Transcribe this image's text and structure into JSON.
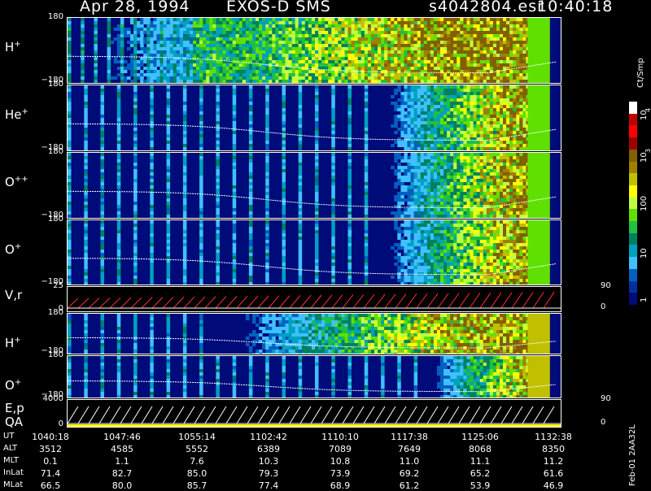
{
  "header": {
    "date": "Apr 28, 1994",
    "mission": "EXOS-D SMS",
    "file": "s4042804.esr",
    "time": "10:40:18"
  },
  "panels": [
    {
      "label": "H",
      "sup": "+",
      "top": "180",
      "bottom": "−180"
    },
    {
      "label": "He",
      "sup": "+",
      "top": "180",
      "bottom": "−180"
    },
    {
      "label": "O",
      "sup": "++",
      "top": "180",
      "bottom": "−180"
    },
    {
      "label": "O",
      "sup": "+",
      "top": "180",
      "bottom": "−180"
    },
    {
      "label": "V,r",
      "sup": "",
      "top": "25",
      "bottom": "0",
      "right_top": "90",
      "right_bottom": "0"
    },
    {
      "label": "H",
      "sup": "+",
      "top": "180",
      "bottom": "−180"
    },
    {
      "label": "O",
      "sup": "+",
      "top": "180",
      "bottom": "−180"
    },
    {
      "label": "E,p",
      "sup": "",
      "label2": "QA",
      "top": "4000",
      "bottom": "0",
      "right_top": "90",
      "right_bottom": "0"
    }
  ],
  "colorbar": {
    "unit": "Ct/Smp",
    "labels": [
      "10",
      "4",
      "10",
      "3",
      "100",
      "10",
      "1"
    ],
    "colors": [
      "#ffffff",
      "#c00000",
      "#ff0000",
      "#a00000",
      "#806000",
      "#a08000",
      "#c0c000",
      "#ffff00",
      "#c0ff40",
      "#60e000",
      "#20c040",
      "#008060",
      "#00a0c0",
      "#40c0ff",
      "#0060c0",
      "#0030a0",
      "#000b7a"
    ]
  },
  "footer_id": "Feb-01 2AA32L",
  "table": {
    "rows": [
      {
        "label": "UT",
        "values": [
          "1040:18",
          "1047:46",
          "1055:14",
          "1102:42",
          "1110:10",
          "1117:38",
          "1125:06",
          "1132:38"
        ]
      },
      {
        "label": "ALT",
        "values": [
          "3512",
          "4585",
          "5552",
          "6389",
          "7089",
          "7649",
          "8068",
          "8350"
        ]
      },
      {
        "label": "MLT",
        "values": [
          "0.1",
          "1.1",
          "7.6",
          "10.3",
          "10.8",
          "11.0",
          "11.1",
          "11.2"
        ]
      },
      {
        "label": "InLat",
        "values": [
          "71.4",
          "82.7",
          "85.0",
          "79.3",
          "73.9",
          "69.2",
          "65.2",
          "61.6"
        ]
      },
      {
        "label": "MLat",
        "values": [
          "66.5",
          "80.0",
          "85.7",
          "77.4",
          "68.9",
          "61.2",
          "53.9",
          "46.9"
        ]
      }
    ]
  },
  "chart_data": {
    "type": "heatmap",
    "title": "Apr 28, 1994   EXOS-D SMS",
    "x_ticks": [
      "1040:18",
      "1047:46",
      "1055:14",
      "1102:42",
      "1110:10",
      "1117:38",
      "1125:06",
      "1132:38"
    ],
    "series": [
      {
        "name": "H+",
        "ylim": [
          -180,
          180
        ]
      },
      {
        "name": "He+",
        "ylim": [
          -180,
          180
        ]
      },
      {
        "name": "O++",
        "ylim": [
          -180,
          180
        ]
      },
      {
        "name": "O+",
        "ylim": [
          -180,
          180
        ]
      },
      {
        "name": "V,r",
        "ylim": [
          0,
          25
        ],
        "y2lim": [
          0,
          90
        ]
      },
      {
        "name": "H+",
        "ylim": [
          -180,
          180
        ]
      },
      {
        "name": "O+",
        "ylim": [
          -180,
          180
        ]
      },
      {
        "name": "E,p",
        "ylim": [
          0,
          4000
        ],
        "y2lim": [
          0,
          90
        ]
      }
    ],
    "colorbar_range": [
      1,
      10000
    ],
    "colorbar_unit": "Ct/Smp"
  }
}
